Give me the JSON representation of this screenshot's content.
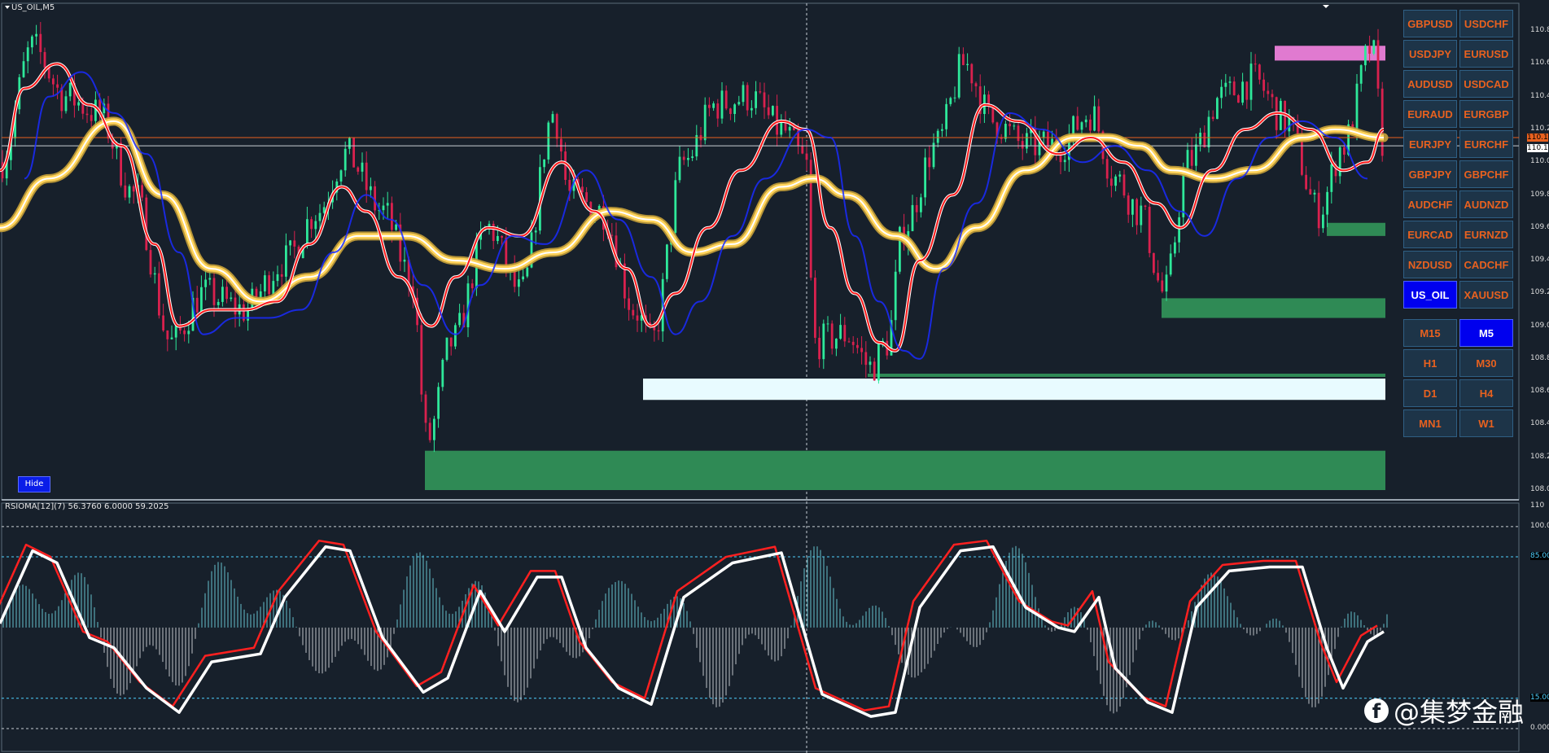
{
  "symbol_label": "US_OIL,M5",
  "indicator_label": "RSIOMA[12](7) 56.3760 6.0000 59.2025",
  "hide_button": "Hide",
  "symbol_buttons": [
    [
      "GBPUSD",
      "USDCHF"
    ],
    [
      "USDJPY",
      "EURUSD"
    ],
    [
      "AUDUSD",
      "USDCAD"
    ],
    [
      "EURAUD",
      "EURGBP"
    ],
    [
      "EURJPY",
      "EURCHF"
    ],
    [
      "GBPJPY",
      "GBPCHF"
    ],
    [
      "AUDCHF",
      "AUDNZD"
    ],
    [
      "EURCAD",
      "EURNZD"
    ],
    [
      "NZDUSD",
      "CADCHF"
    ],
    [
      "US_OIL",
      "XAUUSD"
    ]
  ],
  "active_symbol": "US_OIL",
  "timeframe_buttons": [
    [
      "M15",
      "M5"
    ],
    [
      "H1",
      "M30"
    ],
    [
      "D1",
      "H4"
    ],
    [
      "MN1",
      "W1"
    ]
  ],
  "active_timeframe": "M5",
  "price_axis_ticks": [
    "110.8",
    "110.6",
    "110.4",
    "110.2",
    "110.0",
    "109.8",
    "109.6",
    "109.4",
    "109.2",
    "109.0",
    "108.8",
    "108.6",
    "108.4",
    "108.2",
    "108.0"
  ],
  "current_price_labels": [
    "110.1",
    "110.1"
  ],
  "indicator_axis_ticks": [
    "110",
    "100.0",
    "85.00",
    "15.00",
    "0.000"
  ],
  "watermark": "@集梦金融",
  "colors": {
    "background": "#17202b",
    "bull_candle": "#2ee89a",
    "bear_candle": "#d9214e",
    "fast_ma_blue": "#1a2bff",
    "fast_ma_red": "#ff1a1a",
    "slow_ma_green": "#6de35a",
    "slow_ma_yellow": "#ffd35a",
    "rsi_line": "#ffffff",
    "signal_line": "#ff2020",
    "histogram": "#6ac9d6",
    "button_text": "#e8611f",
    "active_button": "#0000ee"
  },
  "chart_data": [
    {
      "type": "candlestick",
      "title": "US_OIL,M5",
      "ylim": [
        108.0,
        110.9
      ],
      "price_levels": [
        110.15,
        110.1
      ],
      "zones": [
        {
          "color": "#e07ad0",
          "from": 110.62,
          "to": 110.71
        },
        {
          "color": "#2f8a55",
          "from": 109.55,
          "to": 109.63
        },
        {
          "color": "#2f8a55",
          "from": 109.05,
          "to": 109.17
        },
        {
          "color": "#2f8a55",
          "from": 108.69,
          "to": 108.71
        },
        {
          "color": "#e8fbff",
          "from": 108.55,
          "to": 108.68
        },
        {
          "color": "#2f8a55",
          "from": 108.0,
          "to": 108.24
        }
      ]
    },
    {
      "type": "line",
      "title": "RSIOMA[12](7)",
      "ylim": [
        0,
        110
      ],
      "levels": [
        100,
        85,
        15,
        0
      ],
      "series": [
        {
          "name": "RSIOMA",
          "values": [
            56.4
          ]
        },
        {
          "name": "Signal",
          "values": [
            59.2
          ]
        }
      ]
    }
  ]
}
